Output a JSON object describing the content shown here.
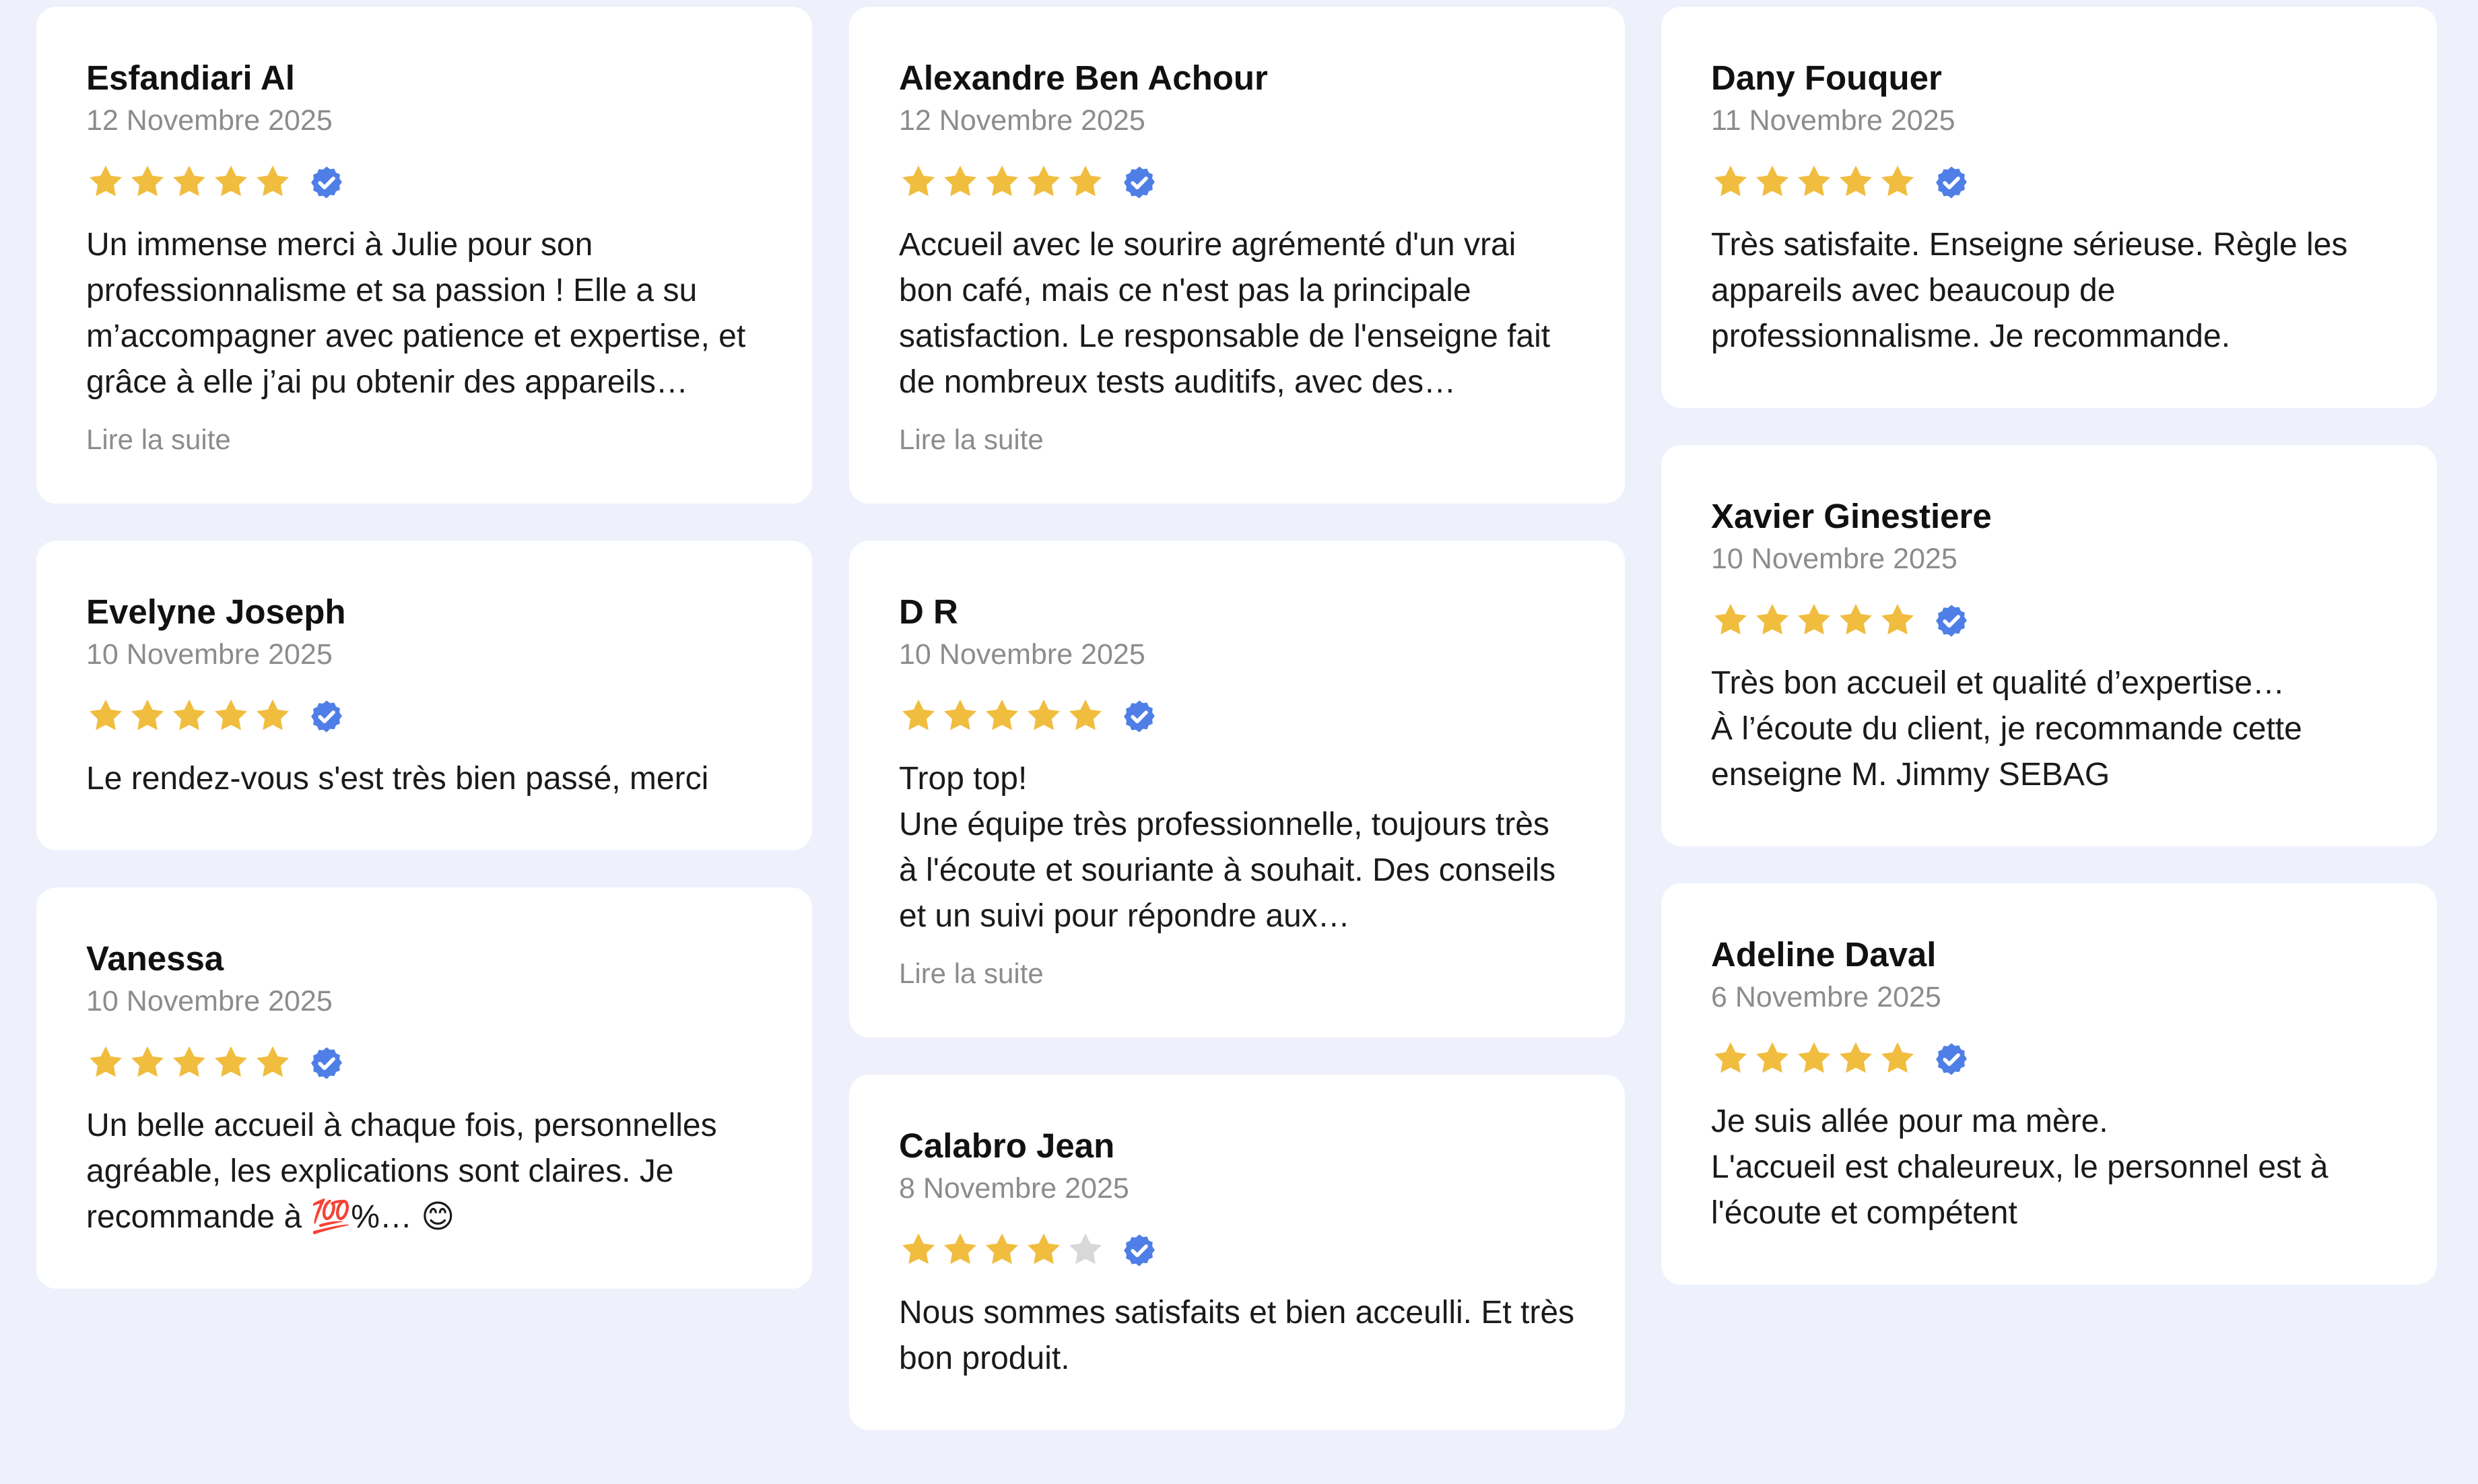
{
  "colors": {
    "background": "#eef0fc",
    "star_filled": "#f0bd3f",
    "star_empty": "#d8d8d8",
    "verified": "#4f7fe6"
  },
  "icons": {
    "star": "star-icon",
    "verified": "verified-badge-icon"
  },
  "columns": [
    [
      {
        "name": "Esfandiari Al",
        "date": "12 Novembre 2025",
        "rating": 5,
        "text": "Un immense merci à Julie pour son professionnalisme et sa passion ! Elle a su m’accompagner avec patience et expertise, et grâce à elle j’ai pu obtenir des appareils…",
        "more": "Lire la suite"
      },
      {
        "name": "Evelyne Joseph",
        "date": "10 Novembre 2025",
        "rating": 5,
        "text": "Le rendez-vous s'est très bien passé, merci",
        "more": null
      },
      {
        "name": "Vanessa",
        "date": "10 Novembre 2025",
        "rating": 5,
        "text": "Un belle accueil à chaque fois, personnelles agréable, les explications sont claires. Je recommande à 💯%… 😊",
        "more": null
      }
    ],
    [
      {
        "name": "Alexandre Ben Achour",
        "date": "12 Novembre 2025",
        "rating": 5,
        "text": "Accueil avec le sourire agrémenté d'un vrai bon café, mais ce n'est pas la principale satisfaction. Le responsable de l'enseigne fait de nombreux tests auditifs, avec des…",
        "more": "Lire la suite"
      },
      {
        "name": "D R",
        "date": "10 Novembre 2025",
        "rating": 5,
        "text": "Trop top!\nUne équipe très professionnelle, toujours très à l'écoute et souriante à souhait. Des conseils et un suivi pour répondre aux…",
        "more": "Lire la suite"
      },
      {
        "name": "Calabro Jean",
        "date": "8 Novembre 2025",
        "rating": 4,
        "text": "Nous sommes satisfaits et bien acceulli. Et très bon produit.",
        "more": null
      }
    ],
    [
      {
        "name": "Dany Fouquer",
        "date": "11 Novembre 2025",
        "rating": 5,
        "text": "Très satisfaite. Enseigne sérieuse. Règle les appareils avec beaucoup de professionnalisme. Je recommande.",
        "more": null
      },
      {
        "name": "Xavier Ginestiere",
        "date": "10 Novembre 2025",
        "rating": 5,
        "text": "Très bon accueil et qualité d’expertise…\nÀ l’écoute du client, je recommande cette enseigne M. Jimmy SEBAG",
        "more": null
      },
      {
        "name": "Adeline Daval",
        "date": "6 Novembre 2025",
        "rating": 5,
        "text": "Je suis allée pour ma mère.\nL'accueil est chaleureux, le personnel est à l'écoute et compétent",
        "more": null
      }
    ]
  ]
}
